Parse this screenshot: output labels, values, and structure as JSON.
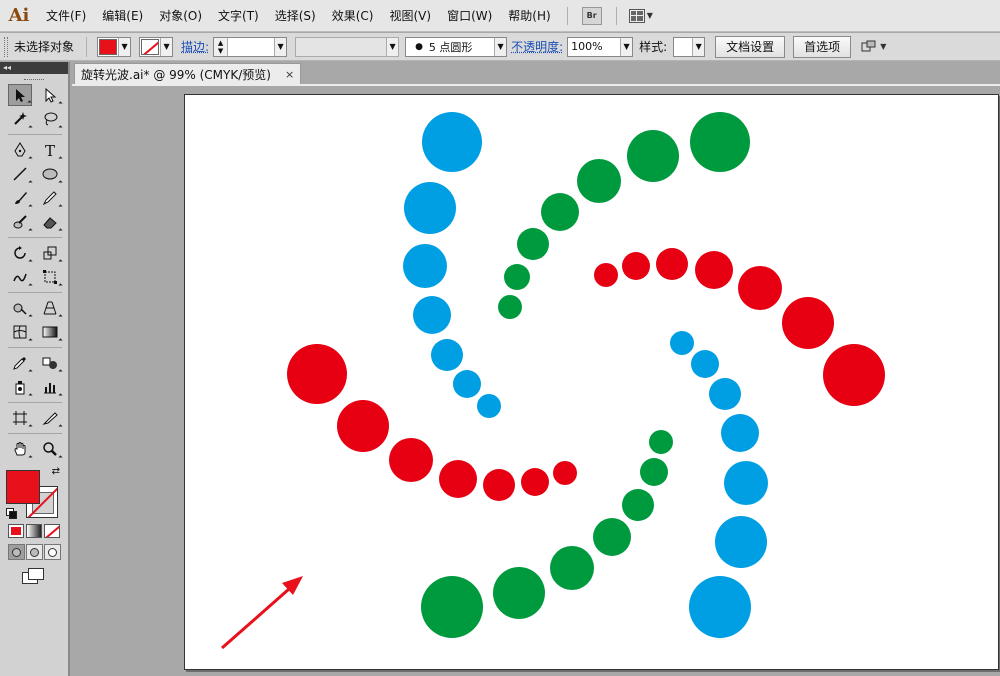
{
  "app": {
    "logo": "Ai"
  },
  "menu": {
    "items": [
      "文件(F)",
      "编辑(E)",
      "对象(O)",
      "文字(T)",
      "选择(S)",
      "效果(C)",
      "视图(V)",
      "窗口(W)",
      "帮助(H)"
    ],
    "bridge_label": "Br"
  },
  "control": {
    "selection_status": "未选择对象",
    "fill_color": "#e8101a",
    "stroke_label": "描边:",
    "brush_value": "5 点圆形",
    "opacity_label": "不透明度:",
    "opacity_value": "100%",
    "style_label": "样式:",
    "doc_setup_button": "文档设置",
    "preferences_button": "首选项"
  },
  "document": {
    "tab_title": "旋转光波.ai* @ 99% (CMYK/预览)",
    "close_glyph": "×"
  },
  "toolbar": {
    "fill_color": "#e8101a",
    "tools": [
      "selection-tool",
      "direct-selection-tool",
      "magic-wand-tool",
      "lasso-tool",
      "pen-tool",
      "type-tool",
      "line-tool",
      "ellipse-tool",
      "paintbrush-tool",
      "pencil-tool",
      "blob-brush-tool",
      "eraser-tool",
      "rotate-tool",
      "scale-tool",
      "warp-tool",
      "free-transform-tool",
      "shape-builder-tool",
      "perspective-grid-tool",
      "mesh-tool",
      "gradient-tool",
      "eyedropper-tool",
      "blend-tool",
      "symbol-sprayer-tool",
      "column-graph-tool",
      "artboard-tool",
      "slice-tool",
      "hand-tool",
      "zoom-tool"
    ]
  },
  "colors": {
    "red": "#e60012",
    "green": "#009a3e",
    "blue": "#009fe3",
    "arrow": "#e8101a"
  }
}
